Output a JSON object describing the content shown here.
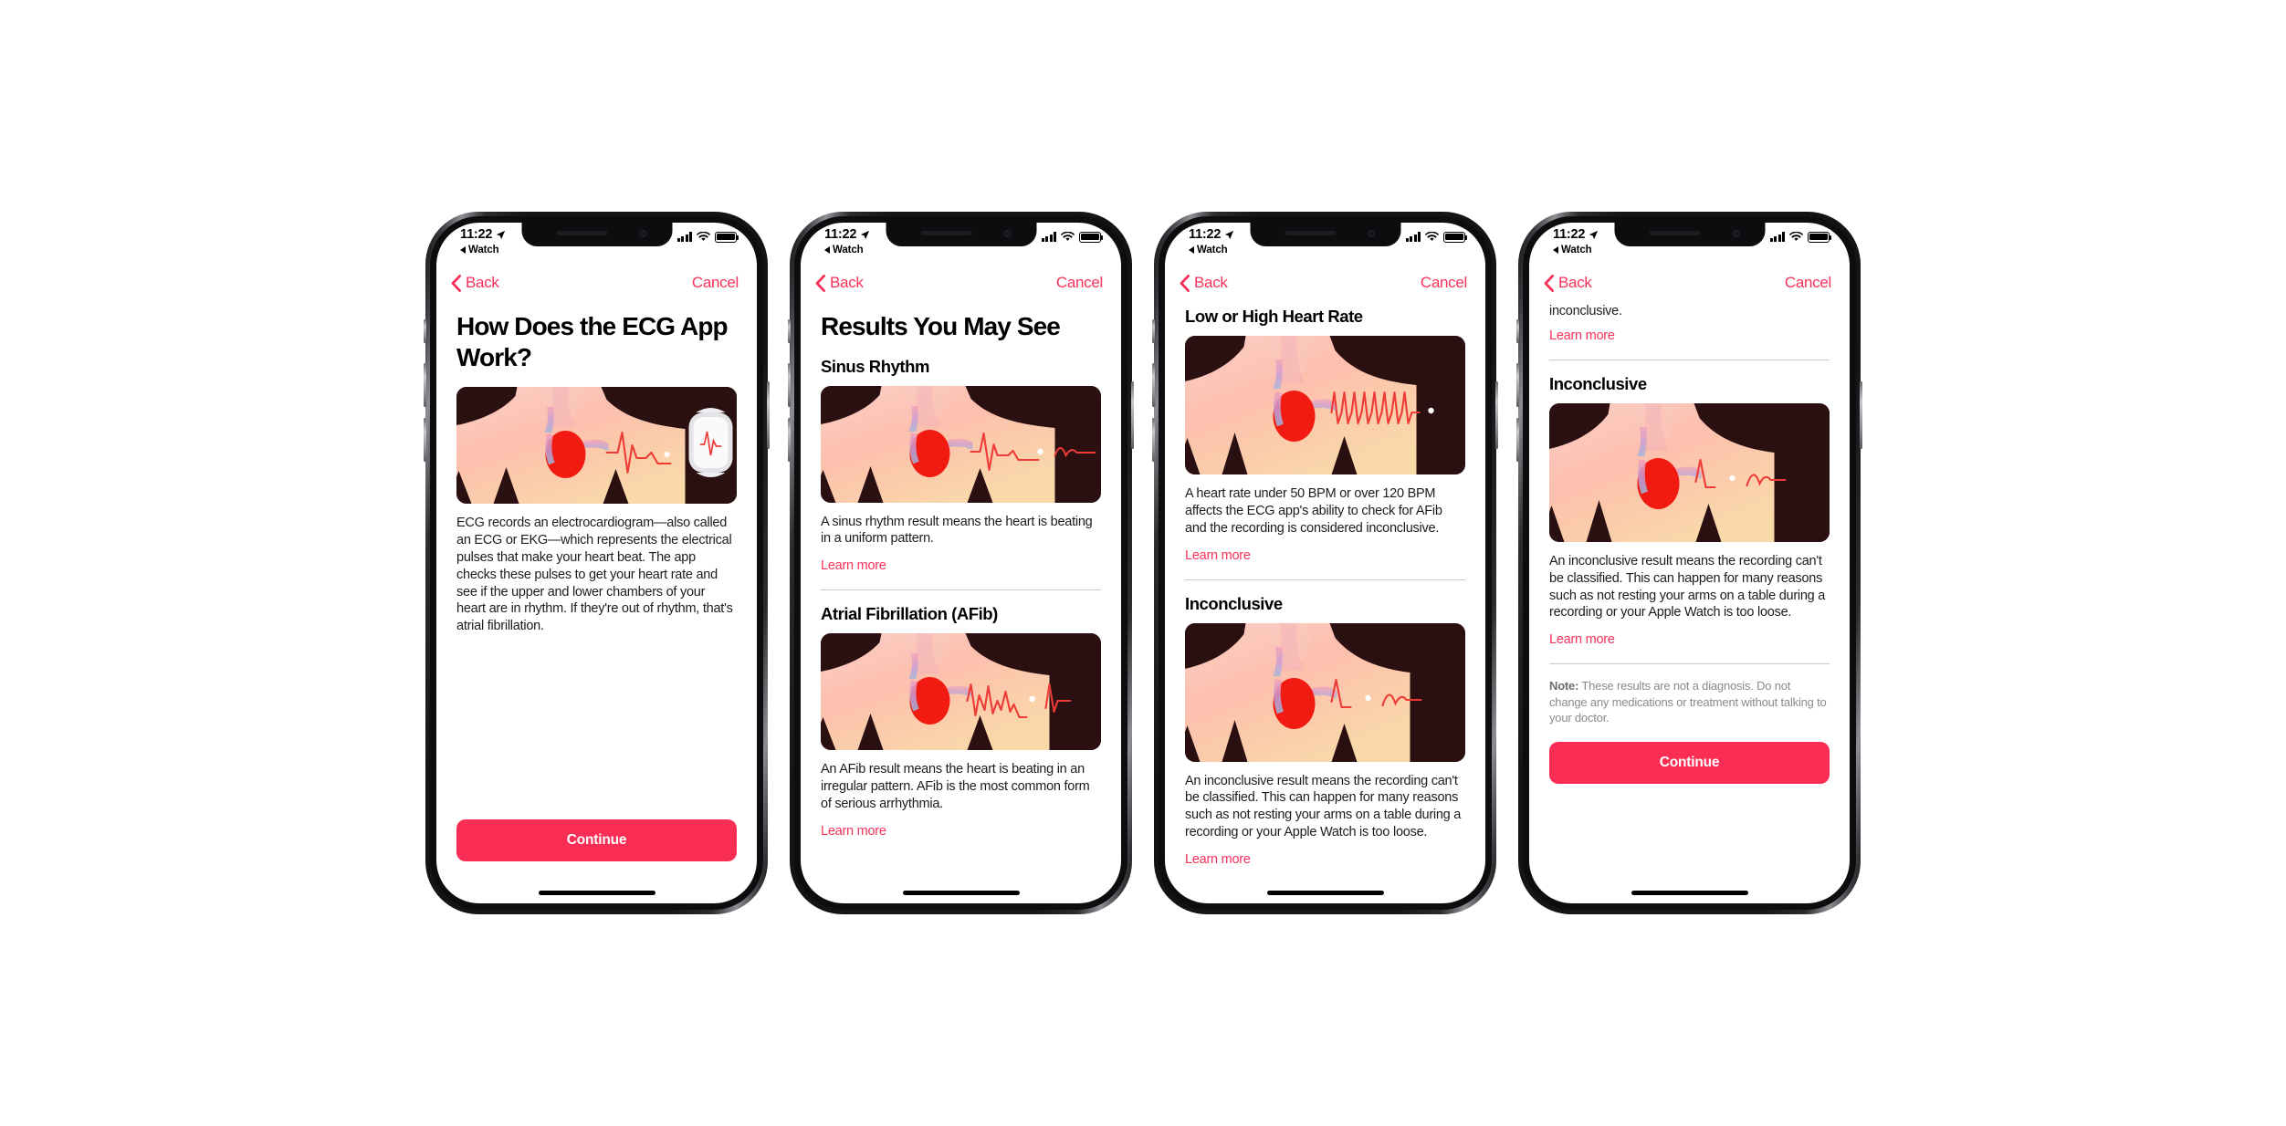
{
  "meta": {
    "accent": "#F8315A",
    "button_color": "#FA2D54",
    "note_color": "#8a8a8e"
  },
  "status_bar": {
    "time": "11:22",
    "back_app": "Watch",
    "location_icon": "location-arrow-icon",
    "signal_icon": "cellular-signal-icon",
    "wifi_icon": "wifi-icon",
    "battery_icon": "battery-full-icon"
  },
  "nav": {
    "back_label": "Back",
    "cancel_label": "Cancel",
    "back_icon": "chevron-left-icon"
  },
  "common": {
    "learn_more": "Learn more",
    "continue": "Continue"
  },
  "screens": [
    {
      "id": "how-does-ecg-app-work",
      "title": "How Does the ECG App Work?",
      "illustration": "torso-heart-ecg-watch-illustration",
      "body": "ECG records an electrocardiogram—also called an ECG or EKG—which represents the electrical pulses that make your heart beat. The app checks these pulses to get your heart rate and see if the upper and lower chambers of your heart are in rhythm. If they're out of rhythm, that's atrial fibrillation.",
      "continue_label": "Continue"
    },
    {
      "id": "results-you-may-see",
      "title": "Results You May See",
      "sections": [
        {
          "heading": "Sinus Rhythm",
          "illustration": "torso-heart-sinus-rhythm-illustration",
          "body": "A sinus rhythm result means the heart is beating in a uniform pattern.",
          "link": "Learn more"
        },
        {
          "heading": "Atrial Fibrillation (AFib)",
          "illustration": "torso-heart-afib-illustration",
          "body": "An AFib result means the heart is beating in an irregular pattern. AFib is the most common form of serious arrhythmia.",
          "link": "Learn more"
        }
      ]
    },
    {
      "id": "results-scrolled-heart-rate",
      "sections": [
        {
          "heading": "Low or High Heart Rate",
          "illustration": "torso-heart-high-rate-illustration",
          "body": "A heart rate under 50 BPM or over 120 BPM affects the ECG app's ability to check for AFib and the recording is considered inconclusive.",
          "link": "Learn more"
        },
        {
          "heading": "Inconclusive",
          "illustration": "torso-heart-inconclusive-illustration",
          "body": "An inconclusive result means the recording can't be classified. This can happen for many reasons such as not resting your arms on a table during a recording or your Apple Watch is too loose.",
          "link": "Learn more"
        }
      ]
    },
    {
      "id": "results-scrolled-bottom",
      "clipped_top_text": "inconclusive.",
      "clipped_top_link": "Learn more",
      "sections": [
        {
          "heading": "Inconclusive",
          "illustration": "torso-heart-inconclusive-illustration",
          "body": "An inconclusive result means the recording can't be classified. This can happen for many reasons such as not resting your arms on a table during a recording or your Apple Watch is too loose.",
          "link": "Learn more"
        }
      ],
      "note_label": "Note:",
      "note_body": " These results are not a diagnosis. Do not change any medications or treatment without talking to your doctor.",
      "continue_label": "Continue"
    }
  ]
}
